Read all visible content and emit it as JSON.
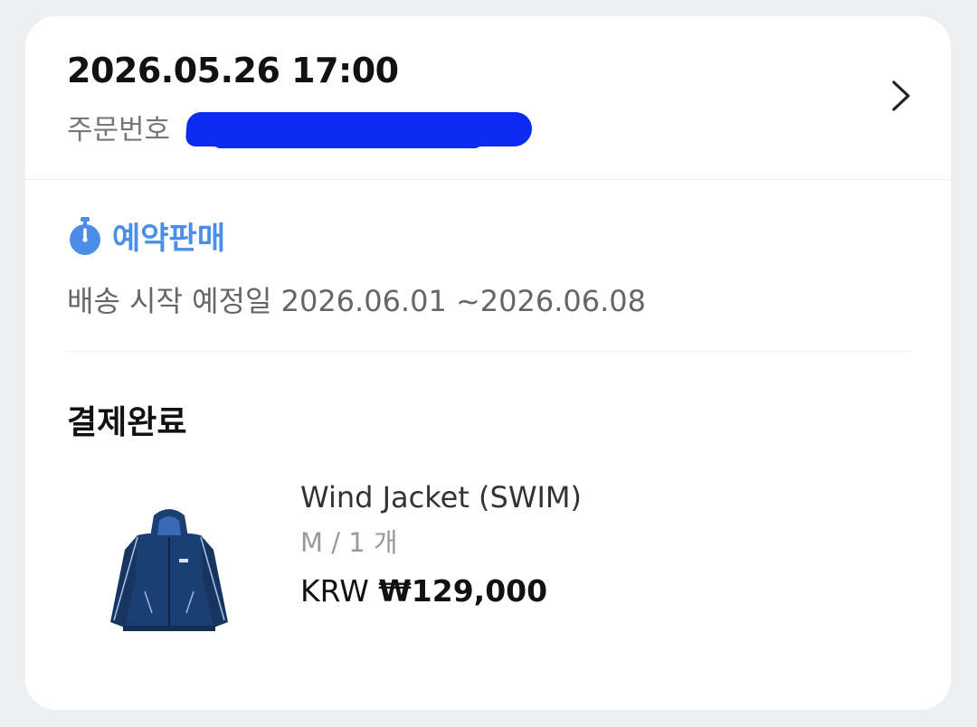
{
  "order": {
    "date": "2026.05.26 17:00",
    "number_label": "주문번호"
  },
  "preorder": {
    "label": "예약판매",
    "icon": "stopwatch-icon",
    "shipping_text": "배송 시작 예정일 2026.06.01 ~2026.06.08"
  },
  "payment": {
    "status": "결제완료"
  },
  "product": {
    "name": "Wind Jacket (SWIM)",
    "option": "M / 1 개",
    "currency": "KRW",
    "price": "₩129,000"
  },
  "colors": {
    "accent": "#4a8ee8",
    "redaction": "#0b2cf0",
    "jacket": "#1c3f73"
  }
}
